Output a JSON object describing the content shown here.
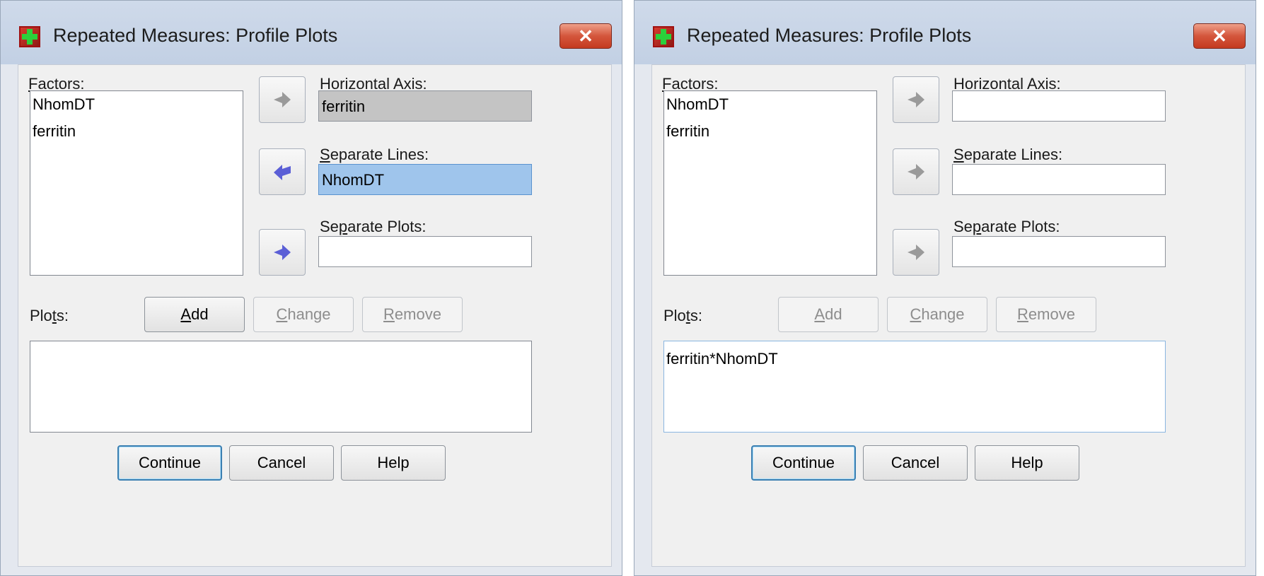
{
  "dialogs": [
    {
      "title": "Repeated Measures: Profile Plots",
      "close_label": "✕",
      "factors_label": "Factors:",
      "factors_hotkey": "F",
      "factors_rest": "actors:",
      "factors": [
        "NhomDT",
        "ferritin"
      ],
      "horizontal_axis_label": {
        "hotkey": "H",
        "rest": "orizontal Axis:"
      },
      "horizontal_axis_value": "ferritin",
      "separate_lines_label": {
        "hotkey": "S",
        "rest": "eparate Lines:"
      },
      "separate_lines_value": "NhomDT",
      "separate_plots_label": {
        "pre": "Se",
        "hotkey": "p",
        "rest": "arate Plots:"
      },
      "separate_plots_value": "",
      "plots_label": {
        "pre": "Plo",
        "hotkey": "t",
        "rest": "s:"
      },
      "add_label": {
        "hotkey": "A",
        "rest": "dd"
      },
      "change_label": {
        "hotkey": "C",
        "rest": "hange"
      },
      "remove_label": {
        "hotkey": "R",
        "rest": "emove"
      },
      "plots_list": "",
      "continue_label": "Continue",
      "cancel_label": "Cancel",
      "help_label": "Help"
    },
    {
      "title": "Repeated Measures: Profile Plots",
      "close_label": "✕",
      "factors_hotkey": "F",
      "factors_rest": "actors:",
      "factors": [
        "NhomDT",
        "ferritin"
      ],
      "horizontal_axis_label": {
        "hotkey": "H",
        "rest": "orizontal Axis:"
      },
      "horizontal_axis_value": "",
      "separate_lines_label": {
        "hotkey": "S",
        "rest": "eparate Lines:"
      },
      "separate_lines_value": "",
      "separate_plots_label": {
        "pre": "Se",
        "hotkey": "p",
        "rest": "arate Plots:"
      },
      "separate_plots_value": "",
      "plots_label": {
        "pre": "Plo",
        "hotkey": "t",
        "rest": "s:"
      },
      "add_label": {
        "hotkey": "A",
        "rest": "dd"
      },
      "change_label": {
        "hotkey": "C",
        "rest": "hange"
      },
      "remove_label": {
        "hotkey": "R",
        "rest": "emove"
      },
      "plots_list": "ferritin*NhomDT",
      "continue_label": "Continue",
      "cancel_label": "Cancel",
      "help_label": "Help"
    }
  ],
  "colors": {
    "arrow_enabled": "#5b5fd6",
    "arrow_disabled": "#9a9a9a",
    "selected_field": "#9fc5ec",
    "disabled_field": "#c4c4c4"
  },
  "icons": {
    "app": "spss-dialog-icon",
    "move_right": "arrow-right-icon",
    "move_left": "arrow-left-icon",
    "close": "close-icon"
  }
}
